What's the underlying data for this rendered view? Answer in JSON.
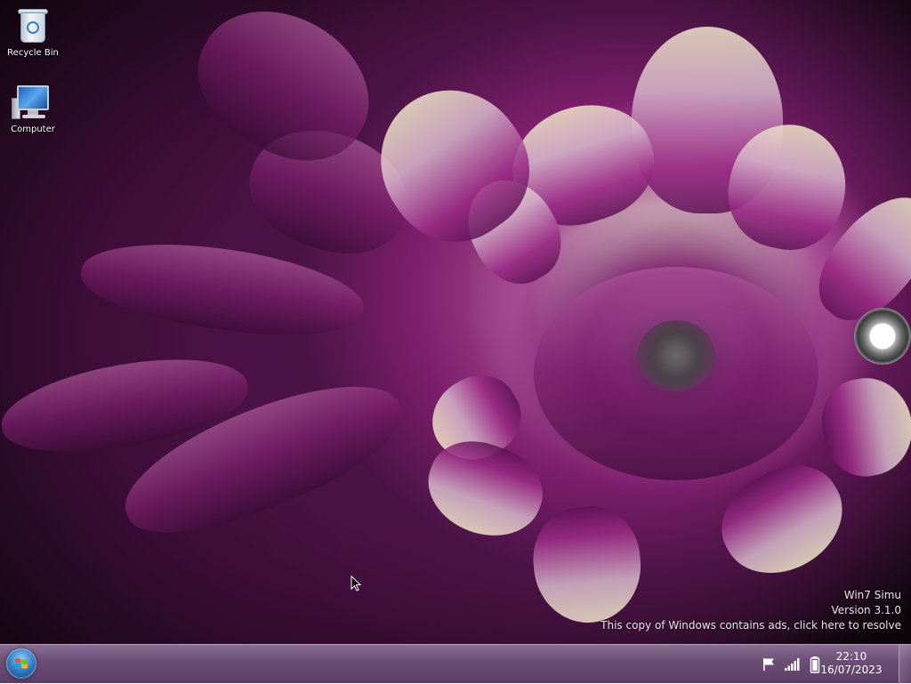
{
  "desktop": {
    "icons": [
      {
        "label": "Recycle Bin",
        "icon": "recycle-bin-icon"
      },
      {
        "label": "Computer",
        "icon": "computer-icon"
      }
    ],
    "watermark": {
      "line1": "Win7 Simu",
      "line2": "Version 3.1.0",
      "line3": "This copy of Windows contains ads, click here to resolve"
    }
  },
  "taskbar": {
    "start_icon": "windows-start-orb-icon",
    "tray": {
      "icons": [
        "action-center-flag-icon",
        "network-signal-icon",
        "battery-icon"
      ],
      "time": "22:10",
      "date": "16/07/2023"
    }
  },
  "colors": {
    "taskbar": "#6e4f78",
    "text": "#ffffff"
  }
}
